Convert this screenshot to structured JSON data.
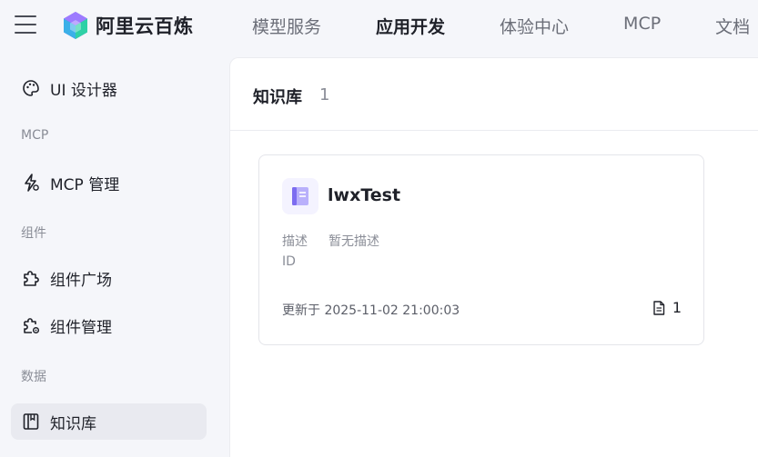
{
  "header": {
    "brand": "阿里云百炼",
    "nav": [
      "模型服务",
      "应用开发",
      "体验中心",
      "MCP",
      "文档"
    ],
    "active_nav": "应用开发"
  },
  "sidebar": {
    "items": [
      {
        "label": "UI 设计器"
      },
      {
        "group": "MCP"
      },
      {
        "label": "MCP 管理"
      },
      {
        "group": "组件"
      },
      {
        "label": "组件广场"
      },
      {
        "label": "组件管理"
      },
      {
        "group": "数据"
      },
      {
        "label": "知识库",
        "active": true
      }
    ]
  },
  "main": {
    "title": "知识库",
    "count": "1",
    "cards": [
      {
        "name": "lwxTest",
        "desc_label": "描述",
        "desc_value": "暂无描述",
        "id_label": "ID",
        "updated": "更新于 2025-11-02 21:00:03",
        "doc_count": "1"
      }
    ]
  },
  "colors": {
    "accent": "#7c6cf0",
    "background": "#f5f6fa",
    "panel": "#ffffff",
    "muted_text": "#8a8d97"
  },
  "icons": [
    "menu-icon",
    "palette-icon",
    "mcp-icon",
    "puzzle-icon",
    "puzzle-gear-icon",
    "book-icon",
    "knowledge-base-icon",
    "document-icon"
  ]
}
